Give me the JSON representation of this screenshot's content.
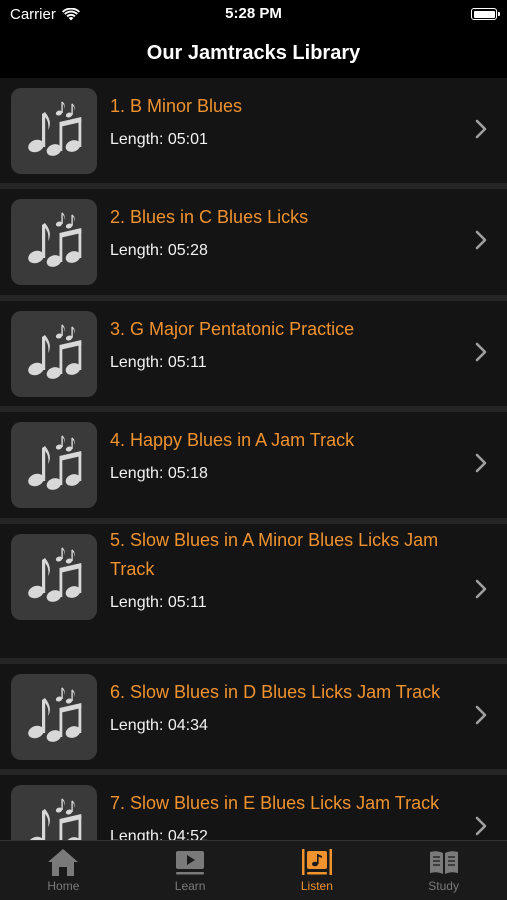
{
  "status": {
    "carrier": "Carrier",
    "time": "5:28 PM"
  },
  "nav": {
    "title": "Our Jamtracks Library"
  },
  "tracks": [
    {
      "title": "1. B Minor Blues",
      "length": "Length: 05:01"
    },
    {
      "title": "2. Blues in C Blues Licks",
      "length": "Length: 05:28"
    },
    {
      "title": "3. G Major Pentatonic Practice",
      "length": "Length: 05:11"
    },
    {
      "title": "4. Happy Blues in A Jam Track",
      "length": "Length: 05:18"
    },
    {
      "title": "5. Slow Blues in A Minor Blues Licks Jam Track",
      "length": "Length: 05:11"
    },
    {
      "title": "6. Slow Blues in D Blues Licks Jam Track",
      "length": "Length: 04:34"
    },
    {
      "title": "7. Slow Blues in E Blues Licks Jam Track",
      "length": "Length: 04:52"
    }
  ],
  "tabs": [
    {
      "label": "Home",
      "icon": "home-icon"
    },
    {
      "label": "Learn",
      "icon": "play-video-icon"
    },
    {
      "label": "Listen",
      "icon": "music-library-icon",
      "active": true
    },
    {
      "label": "Study",
      "icon": "book-icon"
    }
  ],
  "colors": {
    "accent": "#f0922e",
    "background": "#000000",
    "row": "#141414",
    "thumb": "#3a3a3a"
  }
}
